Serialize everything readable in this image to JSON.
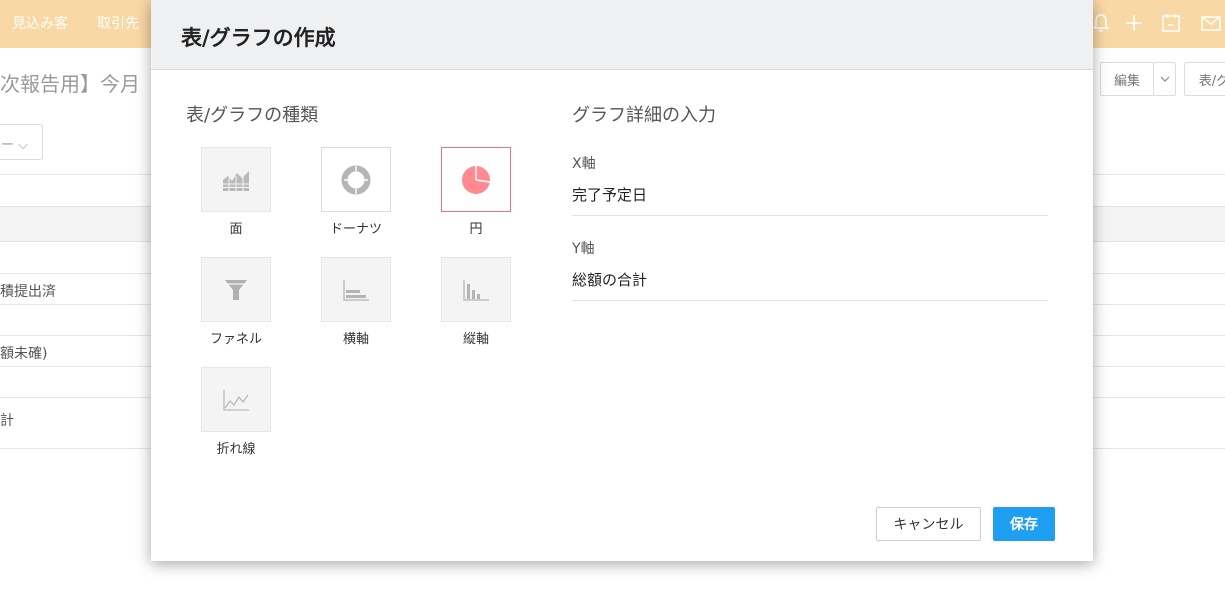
{
  "background": {
    "nav": [
      "見込み客",
      "取引先"
    ],
    "page_title": "次報告用】今月",
    "buttons": {
      "edit": "編集",
      "chart": "表/グ"
    },
    "filter_text": "ー ⌵",
    "rows": [
      "積提出済",
      "額未確)",
      "計"
    ]
  },
  "modal": {
    "title": "表/グラフの作成",
    "chart_types_title": "表/グラフの種類",
    "chart_types": [
      {
        "label": "面",
        "icon": "area-chart-icon",
        "selected": false
      },
      {
        "label": "ドーナツ",
        "icon": "donut-chart-icon",
        "selected": false
      },
      {
        "label": "円",
        "icon": "pie-chart-icon",
        "selected": true
      },
      {
        "label": "ファネル",
        "icon": "funnel-chart-icon",
        "selected": false
      },
      {
        "label": "横軸",
        "icon": "horizontal-bar-chart-icon",
        "selected": false
      },
      {
        "label": "縦軸",
        "icon": "vertical-bar-chart-icon",
        "selected": false
      },
      {
        "label": "折れ線",
        "icon": "line-chart-icon",
        "selected": false
      }
    ],
    "details_title": "グラフ詳細の入力",
    "x_axis": {
      "label": "X軸",
      "value": "完了予定日"
    },
    "y_axis": {
      "label": "Y軸",
      "value": "総額の合計"
    },
    "cancel_label": "キャンセル",
    "save_label": "保存"
  },
  "colors": {
    "topbar": "#f8d8a4",
    "accent_blue": "#1e9ff2",
    "selected_border": "#e8737a",
    "pie_fill": "#ff8a90"
  }
}
